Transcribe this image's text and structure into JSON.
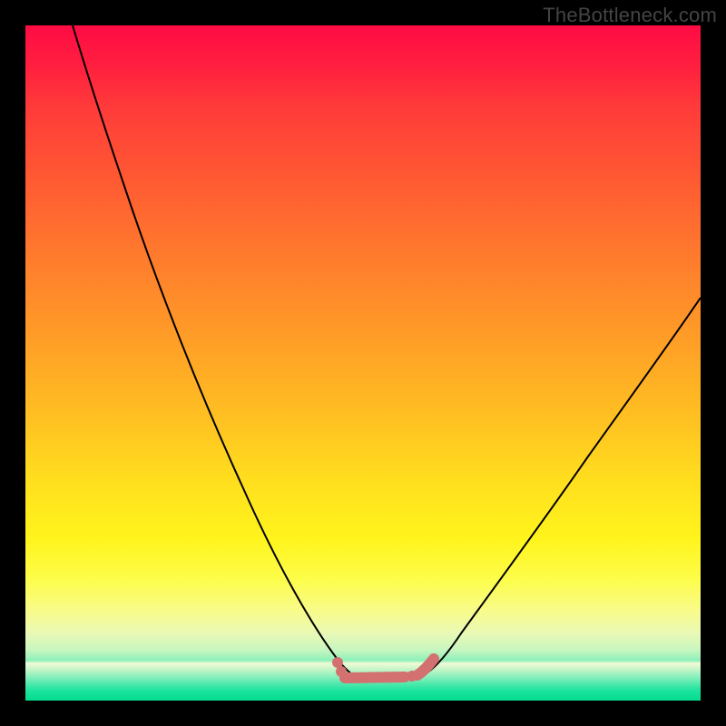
{
  "watermark": "TheBottleneck.com",
  "colors": {
    "background": "#000000",
    "curve": "#000000",
    "valleyMarker": "#d37070",
    "gradient_top": "#ff0b44",
    "gradient_bottom": "#02dc8c"
  },
  "chart_data": {
    "type": "line",
    "title": "",
    "xlabel": "",
    "ylabel": "",
    "xlim": [
      0,
      100
    ],
    "ylim": [
      0,
      100
    ],
    "grid": false,
    "legend": false,
    "series": [
      {
        "name": "left-branch",
        "x": [
          7,
          10,
          14,
          18,
          22,
          26,
          30,
          34,
          38,
          42,
          46,
          48
        ],
        "y": [
          100,
          91,
          80,
          70,
          60,
          50,
          40,
          30,
          20,
          11,
          4,
          3
        ]
      },
      {
        "name": "right-branch",
        "x": [
          58,
          62,
          66,
          72,
          78,
          84,
          90,
          96,
          100
        ],
        "y": [
          3,
          7,
          13,
          22,
          31,
          40,
          48,
          56,
          61
        ]
      },
      {
        "name": "valley-floor",
        "x": [
          48,
          58
        ],
        "y": [
          3,
          3
        ]
      }
    ],
    "annotations": [
      {
        "type": "valley-highlight",
        "x_range": [
          46,
          60
        ],
        "y": 3,
        "color": "#d37070"
      }
    ]
  }
}
